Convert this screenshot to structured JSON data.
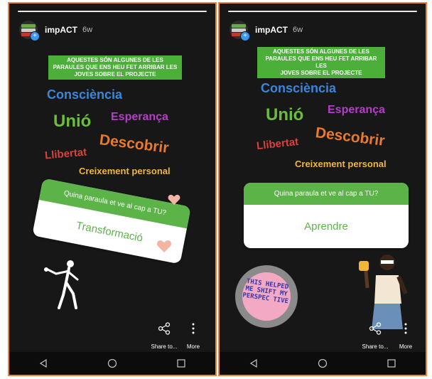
{
  "left": {
    "username": "impACT",
    "time": "6w",
    "caption": "AQUESTES SÓN ALGUNES DE LES\nPARAULES QUE ENS HEU FET ARRIBAR LES\nJOVES SOBRE EL PROJECTE",
    "words": [
      "Consciència",
      "Unió",
      "Esperança",
      "Descobrir",
      "Llibertat",
      "Creixement personal"
    ],
    "poll": {
      "question": "Quina paraula et ve al cap a TU?",
      "answer": "Transformació"
    },
    "share_label": "Share to...",
    "more_label": "More"
  },
  "right": {
    "username": "impACT",
    "time": "6w",
    "caption": "AQUESTES SÓN ALGUNES DE LES\nPARAULES QUE ENS HEU FET ARRIBAR LES\nJOVES SOBRE EL PROJECTE",
    "words": [
      "Consciència",
      "Unió",
      "Esperança",
      "Descobrir",
      "Llibertat",
      "Creixement personal"
    ],
    "poll": {
      "question": "Quina paraula et ve al cap a TU?",
      "answer": "Aprendre"
    },
    "sticker_text": "THIS HELPED ME SHIFT MY PERSPEC TIVE",
    "share_label": "Share to...",
    "more_label": "More"
  },
  "colors": {
    "frame": "#e8833a",
    "caption_green": "#4caf3a",
    "poll_green": "#5cb449",
    "word_blue": "#3a86d8",
    "word_green": "#6abf3a",
    "word_purple": "#b43ec9",
    "word_orange": "#ea7a28",
    "word_red": "#d94040",
    "word_yellow": "#f2b53a"
  },
  "icons": [
    "share-icon",
    "more-vertical-icon",
    "nav-back-icon",
    "nav-home-icon",
    "nav-recents-icon",
    "heart-icon"
  ]
}
